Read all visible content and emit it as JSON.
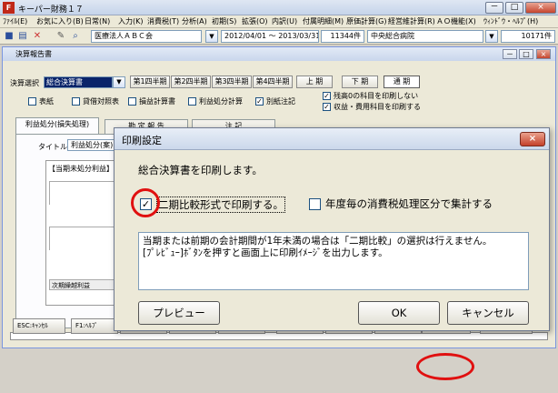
{
  "app": {
    "icon_letter": "F",
    "title": "キーパー財務１７"
  },
  "window_buttons": [
    "－",
    "□",
    "×"
  ],
  "menu": [
    "ﾌｧｲﾙ(E)",
    "お気に入り(B)",
    "日常(N)",
    "入力(K)",
    "消費税(T)",
    "分析(A)",
    "初期(S)",
    "拡張(O)",
    "内訳(U)",
    "付属明細(M)",
    "原価計算(G)",
    "経営維計算(R)",
    "ＡＯ機能(X)",
    "ｳｨﾝﾄﾞｳ・ﾍﾙﾌﾟ(H)"
  ],
  "toolbar": {
    "company": "医療法人ＡＢＣ会",
    "period": "2012/04/01 ～ 2013/03/31",
    "count1": "11344件",
    "dept": "中央総合病院",
    "count2": "10171件"
  },
  "report": {
    "title": "決算報告書",
    "selection_label": "決算選択",
    "selection_value": "総合決算書",
    "periods": [
      "第1四半期",
      "第2四半期",
      "第3四半期",
      "第4四半期",
      "上 期",
      "下 期",
      "通 期"
    ],
    "options": [
      {
        "label": "表紙",
        "checked": false
      },
      {
        "label": "貸借対照表",
        "checked": false
      },
      {
        "label": "損益計算書",
        "checked": false
      },
      {
        "label": "利益処分計算",
        "checked": false
      },
      {
        "label": "別紙注記",
        "checked": true
      }
    ],
    "right_options": [
      {
        "label": "残高0の科目を印刷しない",
        "checked": true
      },
      {
        "label": "収益・費用科目を印刷する",
        "checked": true
      }
    ],
    "tabs": [
      "利益処分(損失処理)",
      "勘 定 報 告",
      "注 記"
    ],
    "title_label": "タイトル",
    "title_value": "利益処分(案)",
    "section_label": "【当期未処分利益】",
    "carry_label": "次期繰越利益"
  },
  "fkeys": [
    "ESC:ｷｬﾝｾﾙ",
    "F1:ﾍﾙﾌﾟ",
    "F2:",
    "F3:",
    "F4:",
    "F5:",
    "F6:",
    "F7:",
    "F8:印刷",
    "F12:閉じる"
  ],
  "dialog": {
    "title": "印刷設定",
    "close": "×",
    "heading": "総合決算書を印刷します。",
    "option1": {
      "label": "二期比較形式で印刷する。",
      "checked": true
    },
    "option2": {
      "label": "年度毎の消費税処理区分で集計する",
      "checked": false
    },
    "note": "当期または前期の会計期間が1年未満の場合は「二期比較」の選択は行えません。\n[ﾌﾟﾚﾋﾞｭｰ]ﾎﾞﾀﾝを押すと画面上に印刷ｲﾒｰｼﾞを出力します。",
    "buttons": {
      "preview": "プレビュー",
      "ok": "OK",
      "cancel": "キャンセル"
    }
  },
  "colors": {
    "highlight_ring": "#e01010",
    "selection": "#0a246a"
  }
}
